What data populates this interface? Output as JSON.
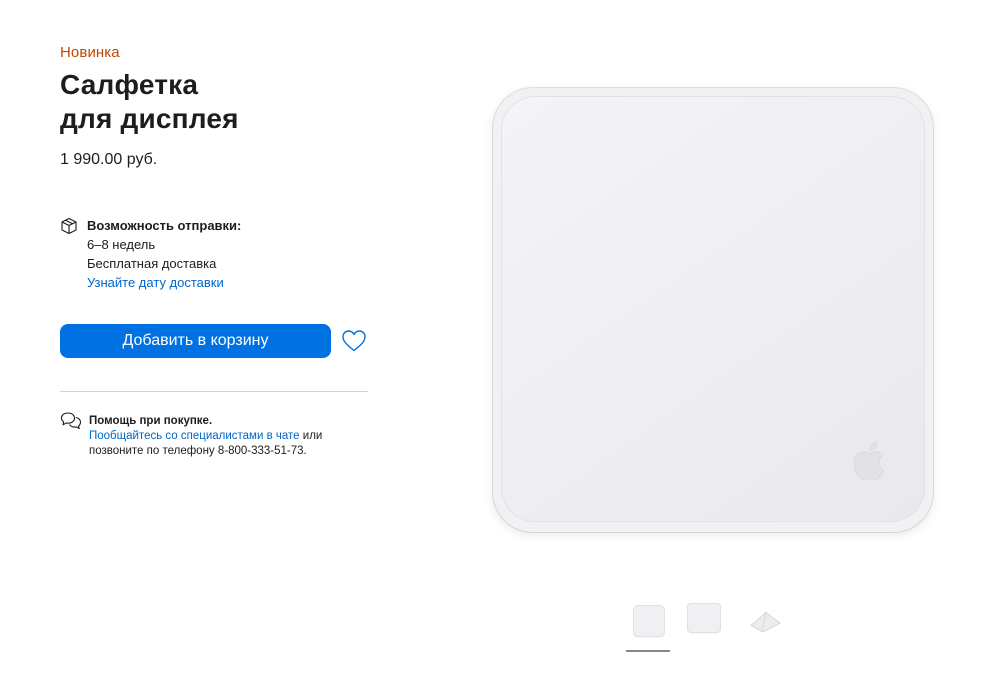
{
  "product": {
    "badge": "Новинка",
    "title_line1": "Салфетка",
    "title_line2": "для дисплея",
    "price": "1 990.00 руб."
  },
  "shipping": {
    "icon": "box-icon",
    "heading": "Возможность отправки:",
    "time": "6–8 недель",
    "delivery": "Бесплатная доставка",
    "link": "Узнайте дату доставки"
  },
  "actions": {
    "add_to_cart": "Добавить в корзину",
    "favorite_icon": "heart-icon"
  },
  "help": {
    "icon": "chat-bubbles-icon",
    "heading": "Помощь при покупке.",
    "chat_link": "Пообщайтесь со специалистами в чате",
    "or": "или",
    "phone_text": "позвоните по телефону 8-800-333-51-73."
  },
  "gallery": {
    "selected_index": 0,
    "thumbnails": [
      "cloth-front-thumb",
      "cloth-angle-thumb",
      "cloth-folded-thumb"
    ]
  },
  "colors": {
    "accent_orange": "#bf4800",
    "button_blue": "#0071e3",
    "link_blue": "#0066cc"
  }
}
